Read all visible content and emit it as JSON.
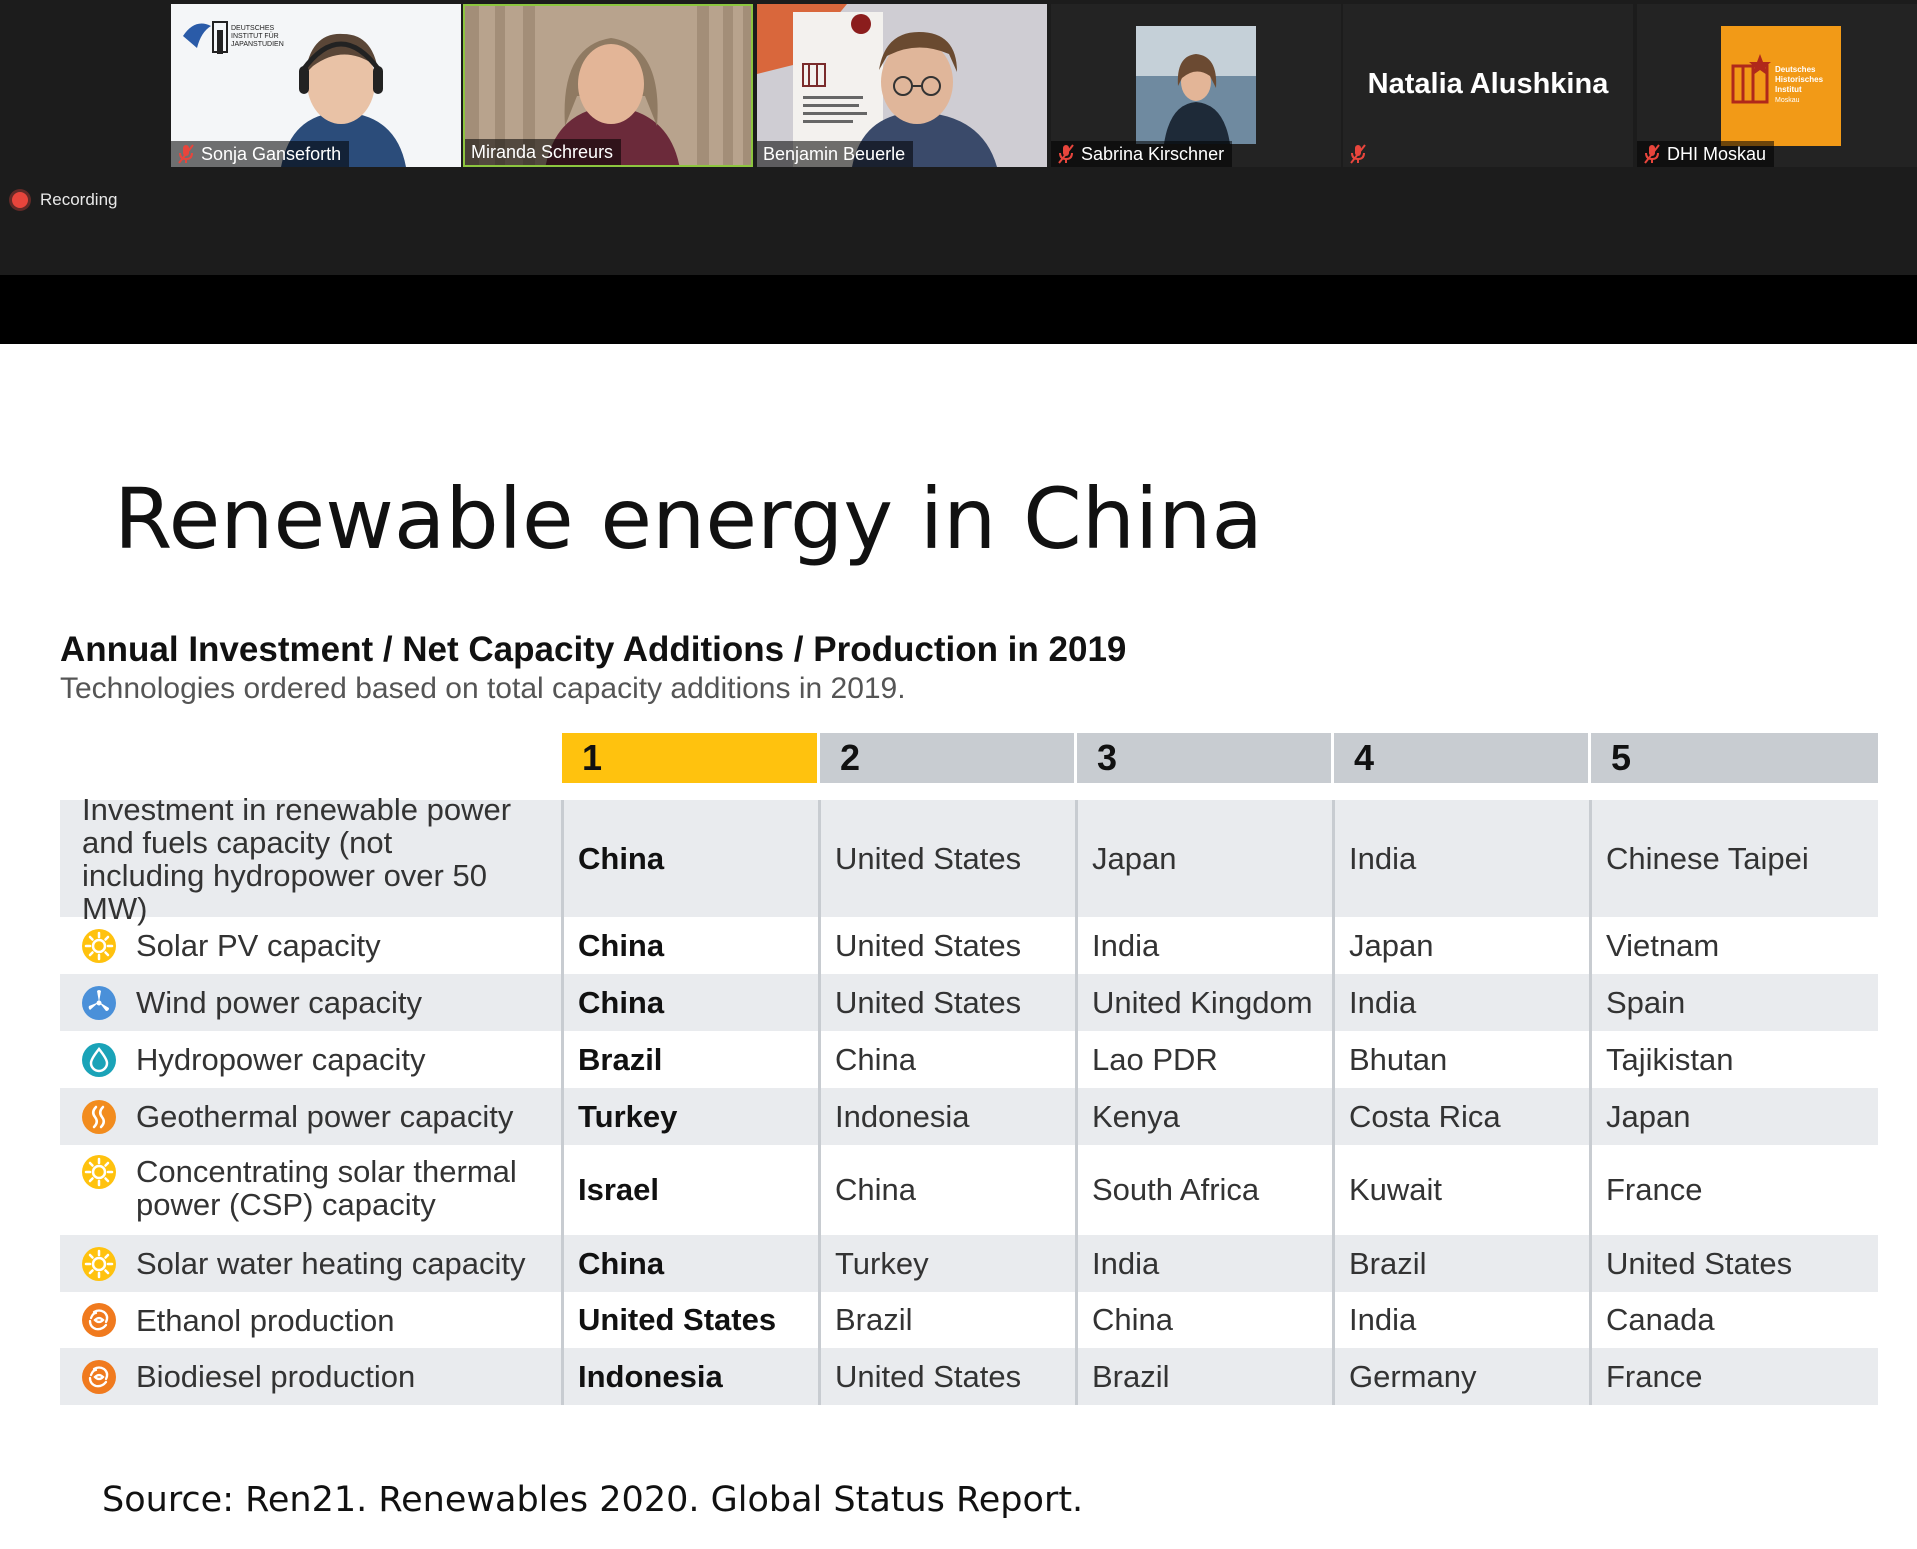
{
  "meeting": {
    "participants": [
      {
        "name": "Sonja Ganseforth",
        "muted": true,
        "active": false
      },
      {
        "name": "Miranda Schreurs",
        "muted": false,
        "active": true
      },
      {
        "name": "Benjamin Beuerle",
        "muted": false,
        "active": false
      },
      {
        "name": "Sabrina Kirschner",
        "muted": true,
        "active": false
      },
      {
        "name": "Natalia Alushkina",
        "muted": true,
        "active": false
      },
      {
        "name": "DHI Moskau",
        "muted": true,
        "active": false
      }
    ],
    "recording_label": "Recording"
  },
  "slide": {
    "title": "Renewable energy in China",
    "table_heading": "Annual Investment / Net Capacity Additions / Production in 2019",
    "table_subheading": "Technologies ordered based on total capacity additions in 2019.",
    "rank_headers": [
      "1",
      "2",
      "3",
      "4",
      "5"
    ],
    "rows": [
      {
        "label": "Investment in renewable power and fuels capacity (not including hydropower over 50 MW)",
        "icon": "none",
        "ranks": [
          "China",
          "United States",
          "Japan",
          "India",
          "Chinese Taipei"
        ]
      },
      {
        "label": "Solar PV capacity",
        "icon": "sun-icon",
        "ranks": [
          "China",
          "United States",
          "India",
          "Japan",
          "Vietnam"
        ]
      },
      {
        "label": "Wind power capacity",
        "icon": "wind-turbine-icon",
        "ranks": [
          "China",
          "United States",
          "United Kingdom",
          "India",
          "Spain"
        ]
      },
      {
        "label": "Hydropower capacity",
        "icon": "water-drop-icon",
        "ranks": [
          "Brazil",
          "China",
          "Lao PDR",
          "Bhutan",
          "Tajikistan"
        ]
      },
      {
        "label": "Geothermal power capacity",
        "icon": "geothermal-icon",
        "ranks": [
          "Turkey",
          "Indonesia",
          "Kenya",
          "Costa Rica",
          "Japan"
        ]
      },
      {
        "label": "Concentrating solar thermal power (CSP) capacity",
        "icon": "sun-icon",
        "ranks": [
          "Israel",
          "China",
          "South Africa",
          "Kuwait",
          "France"
        ]
      },
      {
        "label": "Solar water heating capacity",
        "icon": "sun-icon",
        "ranks": [
          "China",
          "Turkey",
          "India",
          "Brazil",
          "United States"
        ]
      },
      {
        "label": "Ethanol production",
        "icon": "biofuel-icon",
        "ranks": [
          "United States",
          "Brazil",
          "China",
          "India",
          "Canada"
        ]
      },
      {
        "label": "Biodiesel production",
        "icon": "biofuel-icon",
        "ranks": [
          "Indonesia",
          "United States",
          "Brazil",
          "Germany",
          "France"
        ]
      }
    ],
    "source": "Source: Ren21. Renewables 2020. Global Status Report."
  },
  "colors": {
    "rank1_highlight": "#ffc20e",
    "header_gray": "#c8ccd1",
    "row_shade": "#e9ebee",
    "active_speaker_border": "#8dc63f",
    "recording_dot": "#e8453c"
  }
}
